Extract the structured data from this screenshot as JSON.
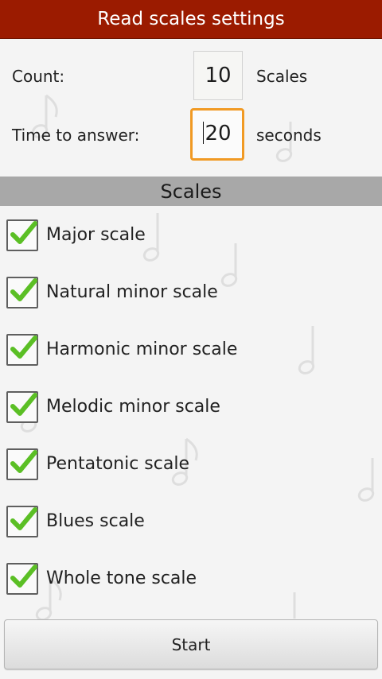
{
  "header": {
    "title": "Read scales settings"
  },
  "settings": {
    "count": {
      "label": "Count:",
      "value": "10",
      "unit": "Scales"
    },
    "time": {
      "label": "Time to answer:",
      "value": "20",
      "unit": "seconds"
    }
  },
  "scales": {
    "heading": "Scales",
    "items": [
      {
        "label": "Major scale",
        "checked": true
      },
      {
        "label": "Natural minor scale",
        "checked": true
      },
      {
        "label": "Harmonic minor scale",
        "checked": true
      },
      {
        "label": "Melodic minor scale",
        "checked": true
      },
      {
        "label": "Pentatonic scale",
        "checked": true
      },
      {
        "label": "Blues scale",
        "checked": true
      },
      {
        "label": "Whole tone scale",
        "checked": true
      }
    ]
  },
  "actions": {
    "start_label": "Start"
  },
  "colors": {
    "title_bar": "#9b1b00",
    "focus_border": "#f19a24",
    "check_green": "#5bbf25",
    "section_header": "#a8a8a8"
  }
}
